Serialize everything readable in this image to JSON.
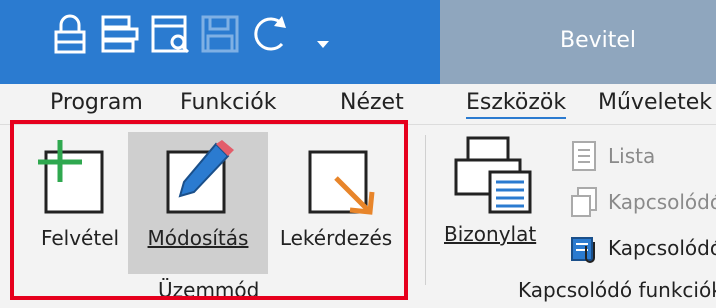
{
  "titlebar": {
    "tab_label": "Bevitel",
    "quick_access": [
      "lock-icon",
      "list-icon",
      "preview-icon",
      "save-icon",
      "refresh-icon",
      "dropdown-icon"
    ]
  },
  "tabs": [
    "Program",
    "Funkciók",
    "Nézet",
    "Eszközök",
    "Műveletek"
  ],
  "ribbon": {
    "mode_group": {
      "label": "Üzemmód",
      "buttons": [
        "Felvétel",
        "Módosítás",
        "Lekérdezés"
      ]
    },
    "related_group": {
      "label": "Kapcsolódó funkciók",
      "large_button": "Bizonylat",
      "items": [
        "Lista",
        "Kapcsolódó",
        "Kapcsolódó"
      ]
    }
  },
  "colors": {
    "accent": "#2b7bd0",
    "highlight": "#e6001d",
    "selected": "#cfcfcf"
  }
}
